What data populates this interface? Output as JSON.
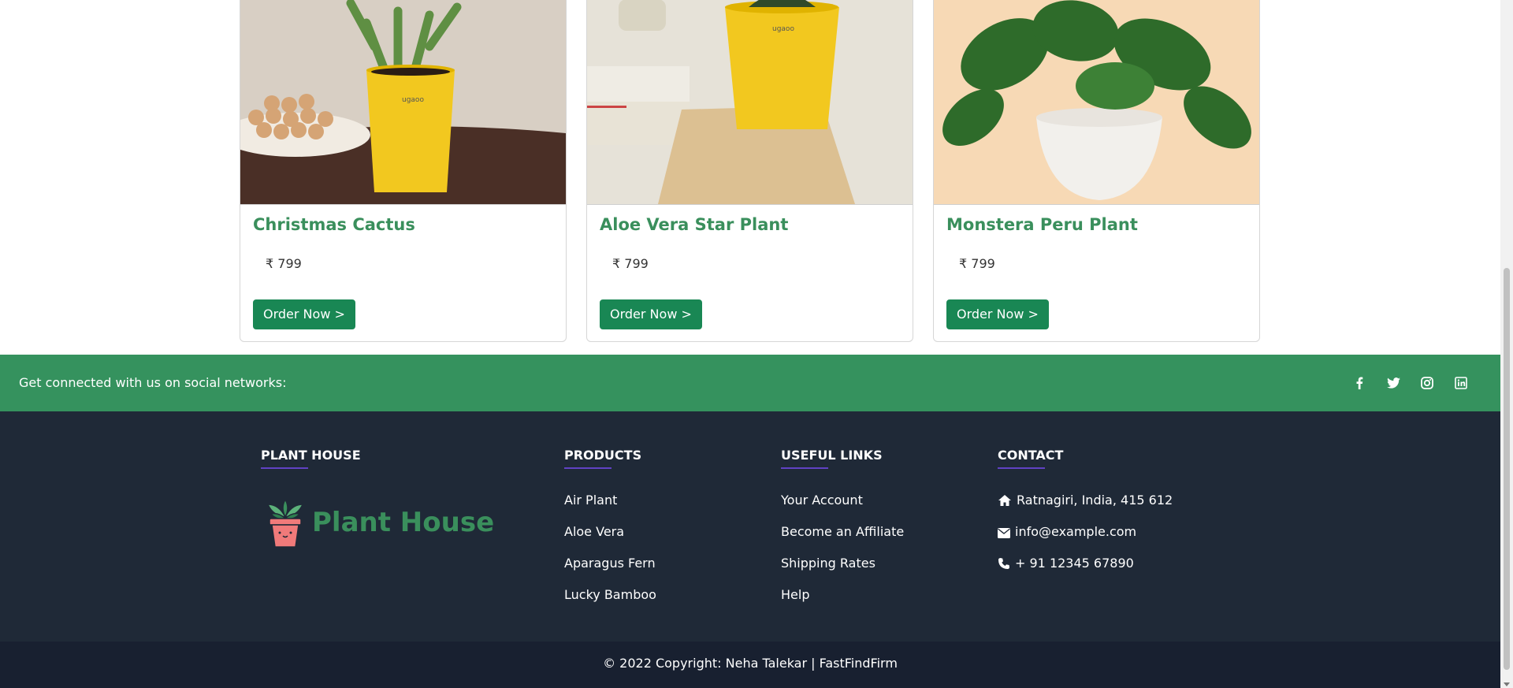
{
  "products": [
    {
      "name": "Christmas Cactus",
      "price": "₹ 799",
      "order_label": "Order Now >"
    },
    {
      "name": "Aloe Vera Star Plant",
      "price": "₹ 799",
      "order_label": "Order Now >"
    },
    {
      "name": "Monstera Peru Plant",
      "price": "₹ 799",
      "order_label": "Order Now >"
    }
  ],
  "social": {
    "text": "Get connected with us on social networks:",
    "icons": [
      "facebook-icon",
      "twitter-icon",
      "instagram-icon",
      "linkedin-icon"
    ]
  },
  "footer": {
    "brand_heading": "PLANT HOUSE",
    "logo_text": "Plant House",
    "products_heading": "PRODUCTS",
    "products": [
      "Air Plant",
      "Aloe Vera",
      "Aparagus Fern",
      "Lucky Bamboo"
    ],
    "links_heading": "USEFUL LINKS",
    "links": [
      "Your Account",
      "Become an Affiliate",
      "Shipping Rates",
      "Help"
    ],
    "contact_heading": "CONTACT",
    "address": "Ratnagiri, India, 415 612",
    "email": "info@example.com",
    "phone": "+ 91 12345 67890"
  },
  "copyright": "© 2022 Copyright: Neha Talekar | FastFindFirm",
  "colors": {
    "brand_green": "#35925e",
    "button_green": "#198754",
    "footer_bg": "#1f2937",
    "title_green": "#3a8f5c"
  }
}
